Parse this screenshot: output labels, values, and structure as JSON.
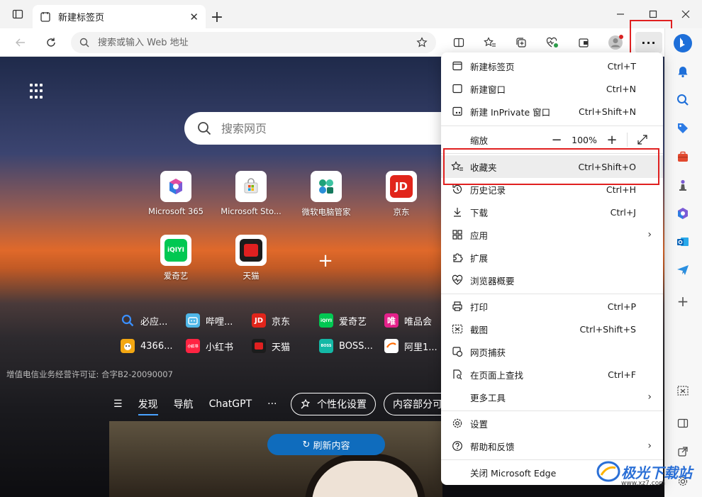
{
  "tab": {
    "title": "新建标签页"
  },
  "address": {
    "placeholder": "搜索或输入 Web 地址"
  },
  "search": {
    "placeholder": "搜索网页"
  },
  "tiles": [
    {
      "label": "Microsoft 365",
      "icon": "microsoft-365-icon"
    },
    {
      "label": "Microsoft Sto...",
      "icon": "microsoft-store-icon"
    },
    {
      "label": "微软电脑管家",
      "icon": "pc-manager-icon"
    },
    {
      "label": "京东",
      "icon": "jd-icon"
    },
    {
      "label": "爱奇艺",
      "icon": "iqiyi-icon"
    },
    {
      "label": "天猫",
      "icon": "tmall-icon"
    }
  ],
  "quick_links": [
    {
      "label": "必应...",
      "icon": "bing-search-icon",
      "badge": ""
    },
    {
      "label": "哔哩...",
      "icon": "bilibili-icon",
      "badge": ""
    },
    {
      "label": "京东",
      "icon": "jd-icon",
      "badge": "JD"
    },
    {
      "label": "爱奇艺",
      "icon": "iqiyi-icon",
      "badge": "iQIYI"
    },
    {
      "label": "唯品会",
      "icon": "vipshop-icon",
      "badge": "唯"
    },
    {
      "label": "4366...",
      "icon": "game-4366-icon",
      "badge": ""
    },
    {
      "label": "小红书",
      "icon": "xiaohongshu-icon",
      "badge": "小红书"
    },
    {
      "label": "天猫",
      "icon": "tmall-icon",
      "badge": ""
    },
    {
      "label": "BOSS...",
      "icon": "boss-zhipin-icon",
      "badge": "BOSS"
    },
    {
      "label": "阿里1...",
      "icon": "alibaba-icon",
      "badge": ""
    }
  ],
  "license": "增值电信业务经营许可证: 合字B2-20090007",
  "feed": {
    "tabs": [
      "发现",
      "导航",
      "ChatGPT",
      "···"
    ],
    "personalize": "个性化设置",
    "content_partial": "内容部分可",
    "refresh": "刷新内容"
  },
  "menu": {
    "new_tab": {
      "label": "新建标签页",
      "shortcut": "Ctrl+T"
    },
    "new_window": {
      "label": "新建窗口",
      "shortcut": "Ctrl+N"
    },
    "new_inprivate": {
      "label": "新建 InPrivate 窗口",
      "shortcut": "Ctrl+Shift+N"
    },
    "zoom": {
      "label": "缩放",
      "value": "100%"
    },
    "favorites": {
      "label": "收藏夹",
      "shortcut": "Ctrl+Shift+O"
    },
    "history": {
      "label": "历史记录",
      "shortcut": "Ctrl+H"
    },
    "downloads": {
      "label": "下载",
      "shortcut": "Ctrl+J"
    },
    "apps": {
      "label": "应用"
    },
    "extensions": {
      "label": "扩展"
    },
    "browser_essentials": {
      "label": "浏览器概要"
    },
    "print": {
      "label": "打印",
      "shortcut": "Ctrl+P"
    },
    "screenshot": {
      "label": "截图",
      "shortcut": "Ctrl+Shift+S"
    },
    "web_capture": {
      "label": "网页捕获"
    },
    "find": {
      "label": "在页面上查找",
      "shortcut": "Ctrl+F"
    },
    "more_tools": {
      "label": "更多工具"
    },
    "settings": {
      "label": "设置"
    },
    "help": {
      "label": "帮助和反馈"
    },
    "close": {
      "label": "关闭 Microsoft Edge"
    }
  },
  "watermark": {
    "text": "极光下载站",
    "sub": "www.xz7.com"
  },
  "colors": {
    "accent": "#0f6cbd",
    "highlight_box": "#e02020"
  }
}
